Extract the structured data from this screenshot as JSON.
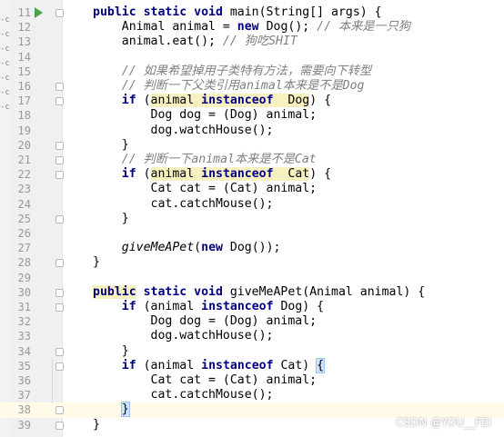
{
  "editor": {
    "left_strip": [
      "-cc",
      "-cc",
      "-cc",
      "-cc",
      "-cc",
      "-cc",
      "-cc"
    ],
    "lines": [
      {
        "n": "11",
        "run": true,
        "fold": true,
        "code": [
          [
            "kw",
            "public static void"
          ],
          [
            "",
            "main(String[] args) {"
          ]
        ]
      },
      {
        "n": "12",
        "code": [
          [
            "",
            "    Animal animal = "
          ],
          [
            "kw",
            "new"
          ],
          [
            "",
            "Dog(); "
          ],
          [
            "cm",
            "// 本来是一只狗"
          ]
        ]
      },
      {
        "n": "13",
        "code": [
          [
            "",
            "    animal.eat(); "
          ],
          [
            "cm",
            "// 狗吃SHIT"
          ]
        ]
      },
      {
        "n": "14",
        "code": []
      },
      {
        "n": "15",
        "code": [
          [
            "cm",
            "    // 如果希望掉用子类特有方法，需要向下转型"
          ]
        ]
      },
      {
        "n": "16",
        "fold": true,
        "code": [
          [
            "cm",
            "    // 判断一下父类引用animal本来是不是Dog"
          ]
        ]
      },
      {
        "n": "17",
        "fold": true,
        "code": [
          [
            "",
            "    "
          ],
          [
            "kw",
            "if"
          ],
          [
            "",
            "("
          ],
          [
            "hl",
            "animal "
          ],
          [
            "hlkw",
            "instanceof"
          ],
          [
            "hl",
            " Dog"
          ],
          [
            "",
            ") {"
          ]
        ]
      },
      {
        "n": "18",
        "code": [
          [
            "",
            "        Dog dog = (Dog) animal;"
          ]
        ]
      },
      {
        "n": "19",
        "code": [
          [
            "",
            "        dog.watchHouse();"
          ]
        ]
      },
      {
        "n": "20",
        "fold": true,
        "code": [
          [
            "",
            "    }"
          ]
        ]
      },
      {
        "n": "21",
        "fold": true,
        "code": [
          [
            "cm",
            "    // 判断一下animal本来是不是Cat"
          ]
        ]
      },
      {
        "n": "22",
        "fold": true,
        "code": [
          [
            "",
            "    "
          ],
          [
            "kw",
            "if"
          ],
          [
            "",
            "("
          ],
          [
            "hl",
            "animal "
          ],
          [
            "hlkw",
            "instanceof"
          ],
          [
            "hl",
            " Cat"
          ],
          [
            "",
            ") {"
          ]
        ]
      },
      {
        "n": "23",
        "code": [
          [
            "",
            "        Cat cat = (Cat) animal;"
          ]
        ]
      },
      {
        "n": "24",
        "code": [
          [
            "",
            "        cat.catchMouse();"
          ]
        ]
      },
      {
        "n": "25",
        "fold": true,
        "code": [
          [
            "",
            "    }"
          ]
        ]
      },
      {
        "n": "26",
        "code": []
      },
      {
        "n": "27",
        "code": [
          [
            "",
            "    "
          ],
          [
            "fn",
            "giveMeAPet"
          ],
          [
            "",
            "("
          ],
          [
            "kw",
            "new"
          ],
          [
            "",
            "Dog());"
          ]
        ]
      },
      {
        "n": "28",
        "fold": true,
        "code": [
          [
            "",
            "}"
          ]
        ]
      },
      {
        "n": "29",
        "code": []
      },
      {
        "n": "30",
        "fold": true,
        "code": [
          [
            "hlkw",
            "public"
          ],
          [
            "kw",
            " static void"
          ],
          [
            "",
            "giveMeAPet(Animal animal) {"
          ]
        ]
      },
      {
        "n": "31",
        "fold": true,
        "code": [
          [
            "",
            "    "
          ],
          [
            "kw",
            "if"
          ],
          [
            "",
            "(animal "
          ],
          [
            "kw",
            "instanceof"
          ],
          [
            "",
            "Dog) {"
          ]
        ]
      },
      {
        "n": "32",
        "code": [
          [
            "",
            "        Dog dog = (Dog) animal;"
          ]
        ]
      },
      {
        "n": "33",
        "code": [
          [
            "",
            "        dog.watchHouse();"
          ]
        ]
      },
      {
        "n": "34",
        "fold": true,
        "code": [
          [
            "",
            "    }"
          ]
        ]
      },
      {
        "n": "35",
        "fold": true,
        "code": [
          [
            "",
            "    "
          ],
          [
            "kw",
            "if"
          ],
          [
            "",
            "(animal "
          ],
          [
            "kw",
            "instanceof"
          ],
          [
            "",
            "Cat) "
          ],
          [
            "brace",
            "{"
          ]
        ]
      },
      {
        "n": "36",
        "code": [
          [
            "",
            "        Cat cat = (Cat) animal;"
          ]
        ]
      },
      {
        "n": "37",
        "code": [
          [
            "",
            "        cat.catchMouse();"
          ]
        ]
      },
      {
        "n": "38",
        "fold": true,
        "caret": true,
        "code": [
          [
            "",
            "    "
          ],
          [
            "brace",
            "}"
          ]
        ]
      },
      {
        "n": "39",
        "fold": true,
        "code": [
          [
            "",
            "}"
          ]
        ]
      }
    ]
  },
  "watermark": "CSDN @YOU__FEI"
}
